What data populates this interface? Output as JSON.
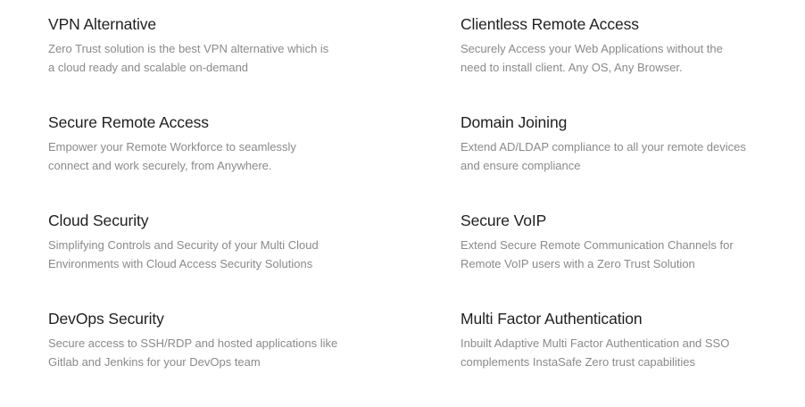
{
  "features": [
    {
      "title": "VPN Alternative",
      "desc_line1": "Zero Trust solution is the best VPN alternative which is",
      "desc_line2": "a cloud ready and scalable on-demand"
    },
    {
      "title": "Clientless Remote Access",
      "desc_line1": "Securely Access your Web Applications without the",
      "desc_line2": "need to install client. Any OS, Any Browser."
    },
    {
      "title": "Secure Remote Access",
      "desc_line1": "Empower your Remote Workforce to seamlessly",
      "desc_line2": "connect and work securely, from Anywhere."
    },
    {
      "title": "Domain Joining",
      "desc_line1": "Extend AD/LDAP compliance to all your remote devices",
      "desc_line2": "and ensure compliance"
    },
    {
      "title": "Cloud Security",
      "desc_line1": "Simplifying Controls and Security of your Multi Cloud",
      "desc_line2": "Environments with Cloud Access Security Solutions"
    },
    {
      "title": "Secure VoIP",
      "desc_line1": "Extend Secure Remote Communication Channels for",
      "desc_line2": "Remote VoIP users with a Zero Trust Solution"
    },
    {
      "title": "DevOps Security",
      "desc_line1": "Secure access to SSH/RDP and hosted applications like",
      "desc_line2": "Gitlab and Jenkins for your DevOps team"
    },
    {
      "title": "Multi Factor Authentication",
      "desc_line1": "Inbuilt Adaptive Multi Factor Authentication and SSO",
      "desc_line2": "complements InstaSafe Zero trust capabilities"
    }
  ]
}
